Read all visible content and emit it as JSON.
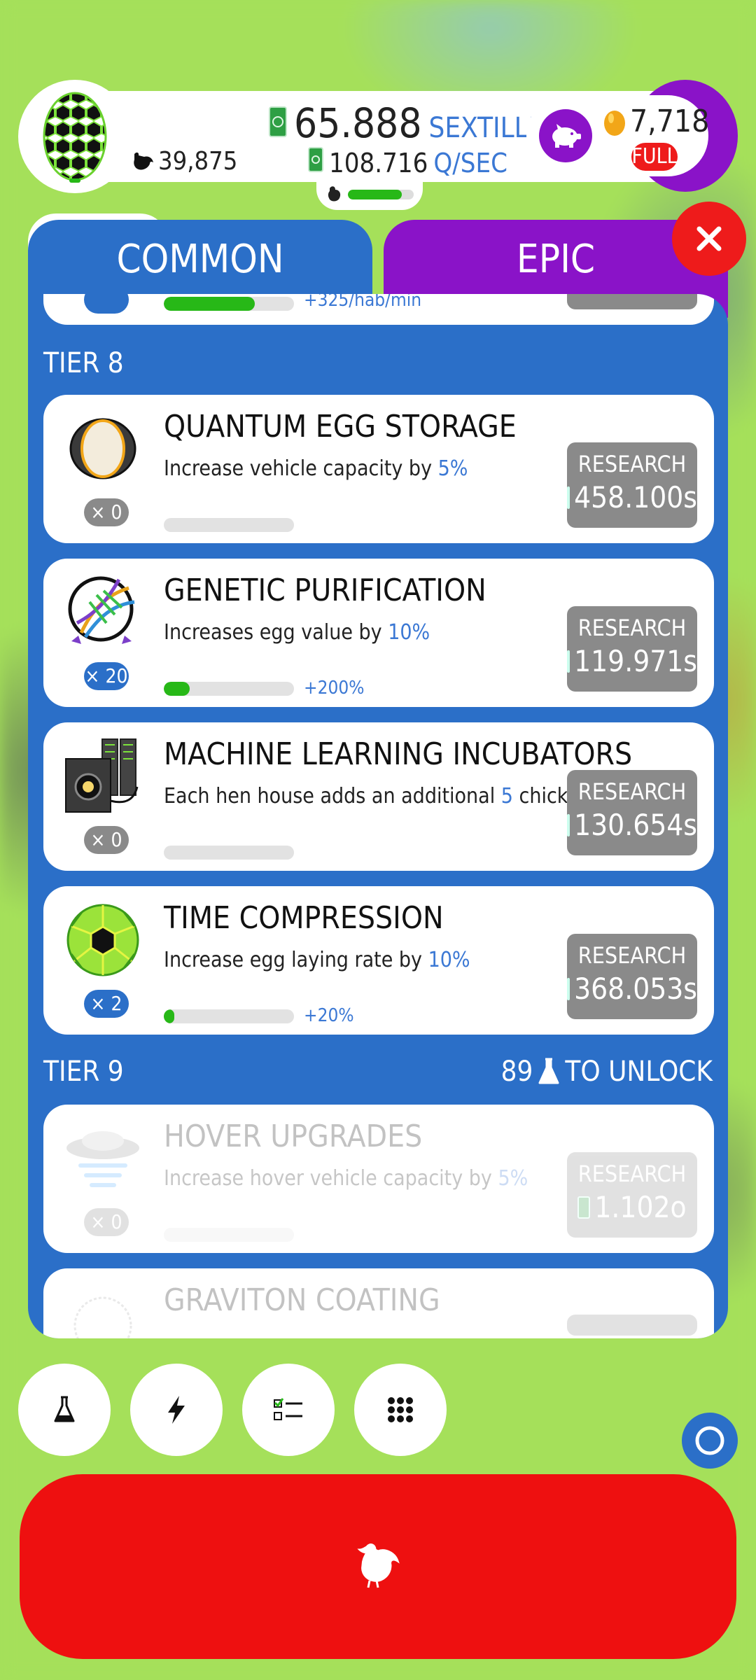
{
  "hud": {
    "chicken_count": "39,875",
    "money_value": "65.888",
    "money_unit": "SEXTILLION",
    "rate_value": "108.716",
    "rate_unit": "Q/SEC",
    "population_fill": 0.82,
    "golden_eggs": "7,718",
    "piggy_status": "FULL"
  },
  "tabs": {
    "common": "COMMON",
    "epic": "EPIC"
  },
  "tiers": {
    "tier8": "TIER 8",
    "tier9": "TIER 9",
    "tier9_unlock_count": "89",
    "tier9_unlock_label": "TO UNLOCK"
  },
  "partial_top": {
    "bonus": "+325/hab/min"
  },
  "research": {
    "items": [
      {
        "icon": "egg-storage-icon",
        "count": "× 0",
        "title": "QUANTUM EGG STORAGE",
        "desc_pre": "Increase vehicle capacity by ",
        "desc_hl": "5%",
        "desc_post": "",
        "progress": 0,
        "bonus": "",
        "btn_label": "RESEARCH",
        "cost": "458.100s"
      },
      {
        "icon": "dna-icon",
        "count": "× 20",
        "title": "GENETIC PURIFICATION",
        "desc_pre": "Increases egg value by ",
        "desc_hl": "10%",
        "desc_post": "",
        "progress": 0.2,
        "bonus": "+200%",
        "btn_label": "RESEARCH",
        "cost": "119.971s"
      },
      {
        "icon": "server-incubator-icon",
        "count": "× 0",
        "title": "MACHINE LEARNING INCUBATORS",
        "desc_pre": "Each hen house adds an additional ",
        "desc_hl": "5",
        "desc_post": " chickens/min",
        "progress": 0,
        "bonus": "",
        "btn_label": "RESEARCH",
        "cost": "130.654s"
      },
      {
        "icon": "time-sphere-icon",
        "count": "× 2",
        "title": "TIME COMPRESSION",
        "desc_pre": "Increase egg laying rate by ",
        "desc_hl": "10%",
        "desc_post": "",
        "progress": 0.08,
        "bonus": "+20%",
        "btn_label": "RESEARCH",
        "cost": "368.053s"
      },
      {
        "icon": "hover-icon",
        "count": "× 0",
        "title": "HOVER UPGRADES",
        "desc_pre": "Increase hover vehicle capacity by ",
        "desc_hl": "5%",
        "desc_post": "",
        "progress": 0,
        "bonus": "",
        "btn_label": "RESEARCH",
        "cost": "1.102o"
      },
      {
        "icon": "graviton-icon",
        "title": "GRAVITON COATING"
      }
    ]
  },
  "colors": {
    "background": "#a5e05a",
    "panel_blue": "#2b6fc8",
    "epic_purple": "#8a13c8",
    "accent_red": "#ee1b1b",
    "progress_green": "#27b817",
    "highlight_blue": "#3b78d4"
  }
}
